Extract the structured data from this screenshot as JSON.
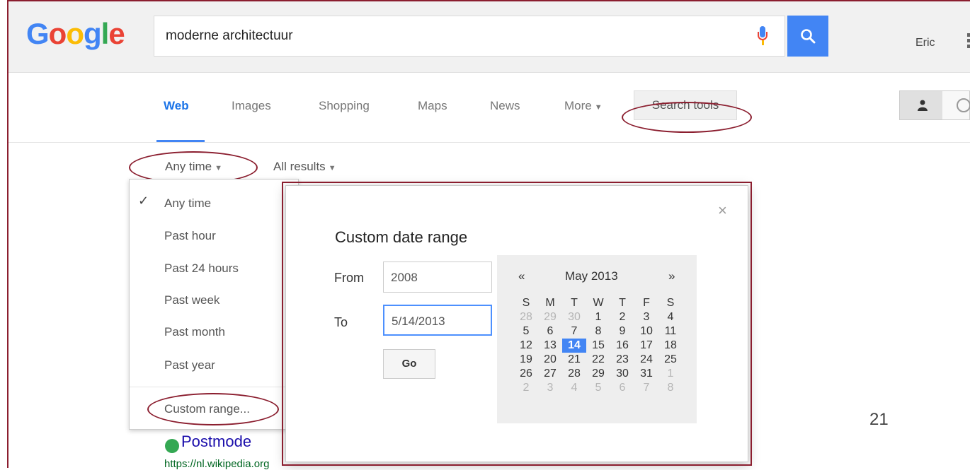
{
  "header": {
    "logo": [
      "G",
      "o",
      "o",
      "g",
      "l",
      "e"
    ],
    "logo_colors": [
      "#4285f4",
      "#ea4335",
      "#fbbc05",
      "#4285f4",
      "#34a853",
      "#ea4335"
    ],
    "search_value": "moderne architectuur",
    "user_name": "Eric"
  },
  "tabs": [
    {
      "label": "Web",
      "active": true
    },
    {
      "label": "Images"
    },
    {
      "label": "Shopping"
    },
    {
      "label": "Maps"
    },
    {
      "label": "News"
    },
    {
      "label": "More"
    }
  ],
  "search_tools_label": "Search tools",
  "tools": {
    "time_label": "Any time",
    "results_label": "All results"
  },
  "time_menu": {
    "items": [
      "Any time",
      "Past hour",
      "Past 24 hours",
      "Past week",
      "Past month",
      "Past year"
    ],
    "selected": "Any time",
    "custom": "Custom range..."
  },
  "dialog": {
    "title": "Custom date range",
    "from_label": "From",
    "from_value": "2008",
    "to_label": "To",
    "to_value": "5/14/2013",
    "go_label": "Go",
    "calendar": {
      "prev": "«",
      "next": "»",
      "month": "May 2013",
      "weekdays": [
        "S",
        "M",
        "T",
        "W",
        "T",
        "F",
        "S"
      ],
      "weeks": [
        [
          "28",
          "29",
          "30",
          "1",
          "2",
          "3",
          "4"
        ],
        [
          "5",
          "6",
          "7",
          "8",
          "9",
          "10",
          "11"
        ],
        [
          "12",
          "13",
          "14",
          "15",
          "16",
          "17",
          "18"
        ],
        [
          "19",
          "20",
          "21",
          "22",
          "23",
          "24",
          "25"
        ],
        [
          "26",
          "27",
          "28",
          "29",
          "30",
          "31",
          "1"
        ],
        [
          "2",
          "3",
          "4",
          "5",
          "6",
          "7",
          "8"
        ]
      ],
      "selected_day": "14"
    }
  },
  "result": {
    "title": "Postmode",
    "url": "https://nl.wikipedia.org"
  },
  "slide_number": "21",
  "colors": {
    "accent": "#4285f4",
    "annotation": "#8b1e2f"
  }
}
